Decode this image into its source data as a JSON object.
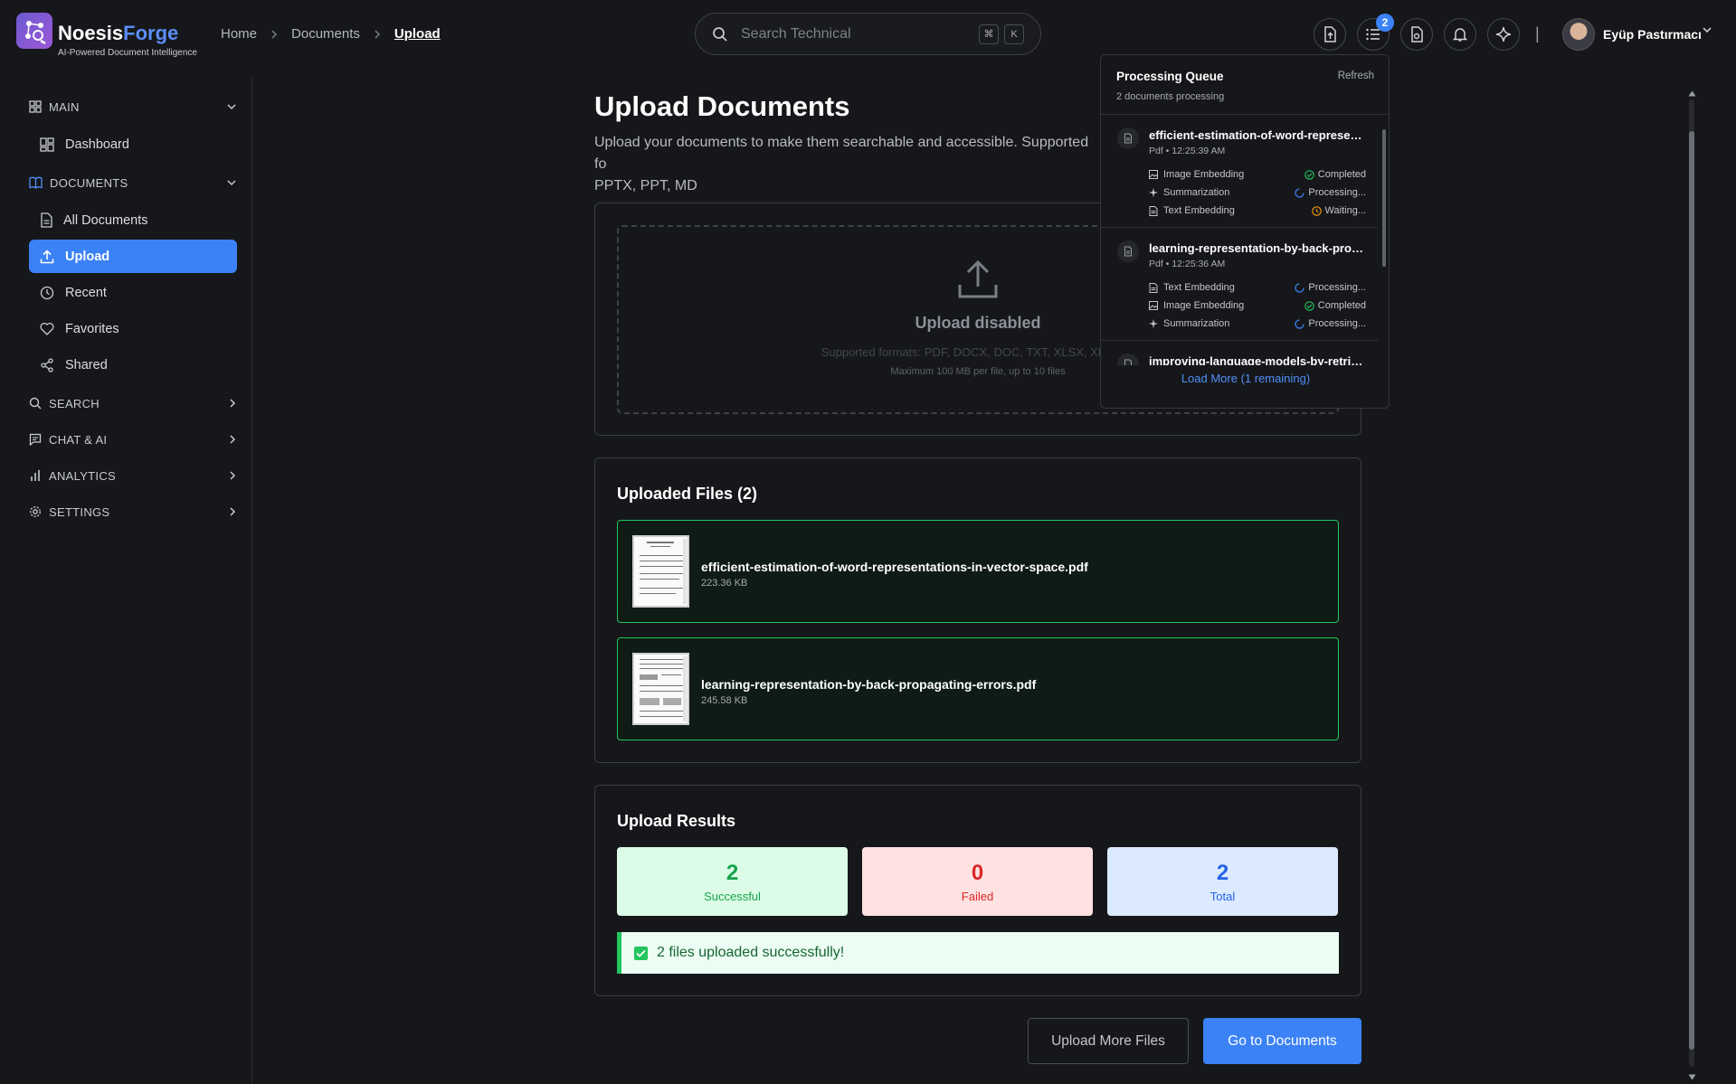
{
  "app": {
    "name_part1": "Noesis",
    "name_part2": "Forge",
    "tagline": "AI-Powered Document Intelligence",
    "accent_color": "#3b82f6"
  },
  "breadcrumb": {
    "items": [
      "Home",
      "Documents",
      "Upload"
    ]
  },
  "search": {
    "placeholder": "Search Technical",
    "shortcut_keys": [
      "⌘",
      "K"
    ]
  },
  "topbar": {
    "queue_badge": "2",
    "divider": "|",
    "user_name": "Eyüp Pastırmacı"
  },
  "sidebar": {
    "sections": [
      {
        "label": "MAIN",
        "icon": "grid-icon",
        "expanded": true
      },
      {
        "label": "DOCUMENTS",
        "icon": "book-icon",
        "expanded": true
      },
      {
        "label": "SEARCH",
        "icon": "search-icon",
        "expanded": false
      },
      {
        "label": "CHAT & AI",
        "icon": "chat-icon",
        "expanded": false
      },
      {
        "label": "ANALYTICS",
        "icon": "bar-chart-icon",
        "expanded": false
      },
      {
        "label": "SETTINGS",
        "icon": "gear-icon",
        "expanded": false
      }
    ],
    "items": [
      {
        "label": "Dashboard",
        "icon": "dashboard-icon",
        "active": false
      },
      {
        "label": "All Documents",
        "icon": "file-icon",
        "active": false
      },
      {
        "label": "Upload",
        "icon": "upload-icon",
        "active": true
      },
      {
        "label": "Recent",
        "icon": "clock-icon",
        "active": false
      },
      {
        "label": "Favorites",
        "icon": "heart-icon",
        "active": false
      },
      {
        "label": "Shared",
        "icon": "share-icon",
        "active": false
      }
    ]
  },
  "main": {
    "title": "Upload Documents",
    "subtitle_line1": "Upload your documents to make them searchable and accessible. Supported fo",
    "subtitle_line2": "PPTX, PPT, MD",
    "dropzone": {
      "title": "Upload disabled",
      "formats": "Supported formats: PDF, DOCX, DOC, TXT, XLSX, XLS, PP",
      "max": "Maximum 100 MB per file, up to 10 files"
    },
    "uploaded": {
      "title": "Uploaded Files (2)",
      "files": [
        {
          "name": "efficient-estimation-of-word-representations-in-vector-space.pdf",
          "size": "223.36 KB"
        },
        {
          "name": "learning-representation-by-back-propagating-errors.pdf",
          "size": "245.58 KB"
        }
      ]
    },
    "results": {
      "title": "Upload Results",
      "successful": {
        "value": "2",
        "label": "Successful",
        "color": "#16a34a"
      },
      "failed": {
        "value": "0",
        "label": "Failed",
        "color": "#dc2626"
      },
      "total": {
        "value": "2",
        "label": "Total",
        "color": "#2563eb"
      },
      "message": "2 files uploaded successfully!"
    },
    "actions": {
      "upload_more": "Upload More Files",
      "go_to_documents": "Go to Documents"
    }
  },
  "queue": {
    "title": "Processing Queue",
    "refresh": "Refresh",
    "count": "2 documents processing",
    "items": [
      {
        "name": "efficient-estimation-of-word-representations-in-vector-space.pdf",
        "meta": "Pdf • 12:25:39 AM",
        "tasks": [
          {
            "name": "Image Embedding",
            "icon": "image-icon",
            "status": "Completed",
            "status_icon": "check-circle-icon"
          },
          {
            "name": "Summarization",
            "icon": "sparkle-icon",
            "status": "Processing...",
            "status_icon": "spinner-icon"
          },
          {
            "name": "Text Embedding",
            "icon": "doc-icon",
            "status": "Waiting...",
            "status_icon": "clock-icon"
          }
        ]
      },
      {
        "name": "learning-representation-by-back-propagating-errors.pdf",
        "meta": "Pdf • 12:25:36 AM",
        "tasks": [
          {
            "name": "Text Embedding",
            "icon": "doc-icon",
            "status": "Processing...",
            "status_icon": "spinner-icon"
          },
          {
            "name": "Image Embedding",
            "icon": "image-icon",
            "status": "Completed",
            "status_icon": "check-circle-icon"
          },
          {
            "name": "Summarization",
            "icon": "sparkle-icon",
            "status": "Processing...",
            "status_icon": "spinner-icon"
          }
        ]
      },
      {
        "name": "improving-language-models-by-retrieving-from-trillions-of-tokens.pdf"
      }
    ],
    "load_more": "Load More (1 remaining)"
  }
}
